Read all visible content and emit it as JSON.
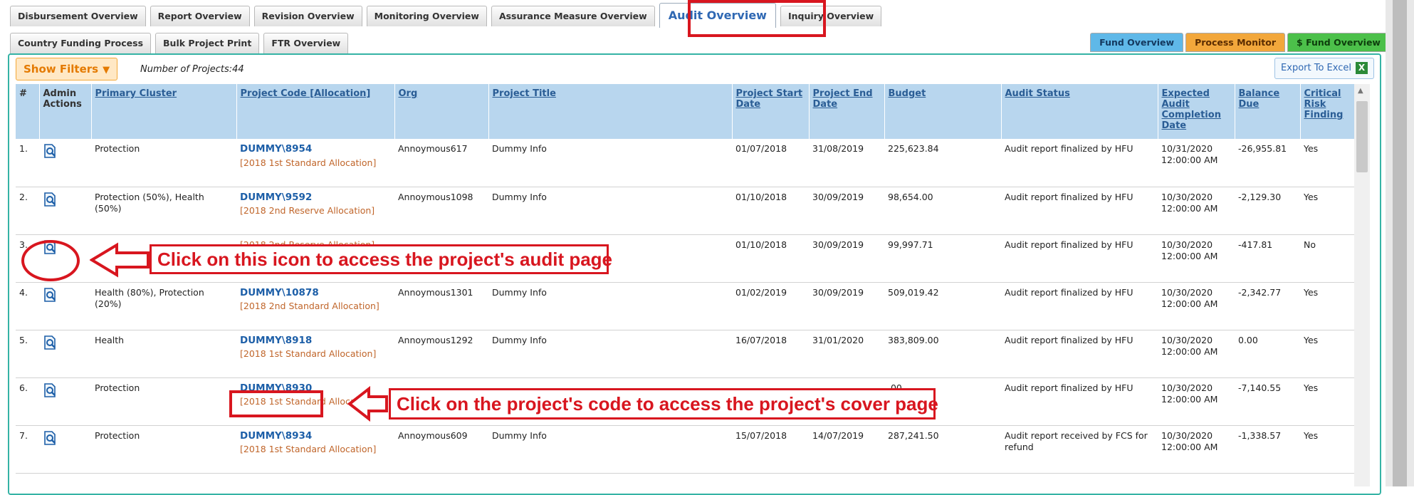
{
  "tabs_row1": [
    {
      "label": "Disbursement Overview"
    },
    {
      "label": "Report Overview"
    },
    {
      "label": "Revision Overview"
    },
    {
      "label": "Monitoring Overview"
    },
    {
      "label": "Assurance Measure Overview"
    },
    {
      "label": "Audit Overview",
      "active": true
    },
    {
      "label": "Inquiry Overview"
    }
  ],
  "tabs_row2": [
    {
      "label": "Country Funding Process"
    },
    {
      "label": "Bulk Project Print"
    },
    {
      "label": "FTR Overview"
    }
  ],
  "right_tabs": [
    {
      "label": "Fund Overview",
      "color": "#5fb8e8"
    },
    {
      "label": "Process Monitor",
      "color": "#f2a73b"
    },
    {
      "label": "$ Fund Overview",
      "color": "#4cc04a"
    }
  ],
  "filter_button": "Show Filters",
  "project_count": "Number of Projects:44",
  "export_label": "Export To Excel",
  "table": {
    "headers": [
      "#",
      "Admin Actions",
      "Primary Cluster",
      "Project Code [Allocation]",
      "Org",
      "Project Title",
      "Project Start Date",
      "Project End Date",
      "Budget",
      "Audit Status",
      "Expected Audit Completion Date",
      "Balance Due",
      "Critical Risk Finding"
    ],
    "rows": [
      {
        "num": "1.",
        "cluster": "Protection",
        "code": "DUMMY\\8954",
        "alloc": "[2018 1st Standard Allocation]",
        "org": "Annoymous617",
        "title": "Dummy Info",
        "start": "01/07/2018",
        "end": "31/08/2019",
        "budget": "225,623.84",
        "status": "Audit report finalized by HFU",
        "completion": "10/31/2020 12:00:00 AM",
        "balance": "-26,955.81",
        "critical": "Yes"
      },
      {
        "num": "2.",
        "cluster": "Protection (50%), Health (50%)",
        "code": "DUMMY\\9592",
        "alloc": "[2018 2nd Reserve Allocation]",
        "org": "Annoymous1098",
        "title": "Dummy Info",
        "start": "01/10/2018",
        "end": "30/09/2019",
        "budget": "98,654.00",
        "status": "Audit report finalized by HFU",
        "completion": "10/30/2020 12:00:00 AM",
        "balance": "-2,129.30",
        "critical": "Yes"
      },
      {
        "num": "3.",
        "cluster": "",
        "code": "",
        "alloc": "[2018 2nd Reserve Allocation]",
        "org": "",
        "title": "",
        "start": "01/10/2018",
        "end": "30/09/2019",
        "budget": "99,997.71",
        "status": "Audit report finalized by HFU",
        "completion": "10/30/2020 12:00:00 AM",
        "balance": "-417.81",
        "critical": "No"
      },
      {
        "num": "4.",
        "cluster": "Health (80%), Protection (20%)",
        "code": "DUMMY\\10878",
        "alloc": "[2018 2nd Standard Allocation]",
        "org": "Annoymous1301",
        "title": "Dummy Info",
        "start": "01/02/2019",
        "end": "30/09/2019",
        "budget": "509,019.42",
        "status": "Audit report finalized by HFU",
        "completion": "10/30/2020 12:00:00 AM",
        "balance": "-2,342.77",
        "critical": "Yes"
      },
      {
        "num": "5.",
        "cluster": "Health",
        "code": "DUMMY\\8918",
        "alloc": "[2018 1st Standard Allocation]",
        "org": "Annoymous1292",
        "title": "Dummy Info",
        "start": "16/07/2018",
        "end": "31/01/2020",
        "budget": "383,809.00",
        "status": "Audit report finalized by HFU",
        "completion": "10/30/2020 12:00:00 AM",
        "balance": "0.00",
        "critical": "Yes"
      },
      {
        "num": "6.",
        "cluster": "Protection",
        "code": "DUMMY\\8930",
        "alloc": "[2018 1st Standard Allocation]",
        "org": "",
        "title": "",
        "start": "",
        "end": "",
        "budget": ".00",
        "status": "Audit report finalized by HFU",
        "completion": "10/30/2020 12:00:00 AM",
        "balance": "-7,140.55",
        "critical": "Yes"
      },
      {
        "num": "7.",
        "cluster": "Protection",
        "code": "DUMMY\\8934",
        "alloc": "[2018 1st Standard Allocation]",
        "org": "Annoymous609",
        "title": "Dummy Info",
        "start": "15/07/2018",
        "end": "14/07/2019",
        "budget": "287,241.50",
        "status": "Audit report received by FCS for refund",
        "completion": "10/30/2020 12:00:00 AM",
        "balance": "-1,338.57",
        "critical": "Yes"
      }
    ]
  },
  "annotations": {
    "icon_hint": "Click on this icon to access the project's audit page",
    "code_hint": "Click on the project's code to access the project's cover page"
  },
  "colors": {
    "annotation_red": "#d8161f",
    "header_blue": "#b8d6ee",
    "link_blue": "#1d5fa8",
    "alloc_orange": "#c0652a"
  }
}
